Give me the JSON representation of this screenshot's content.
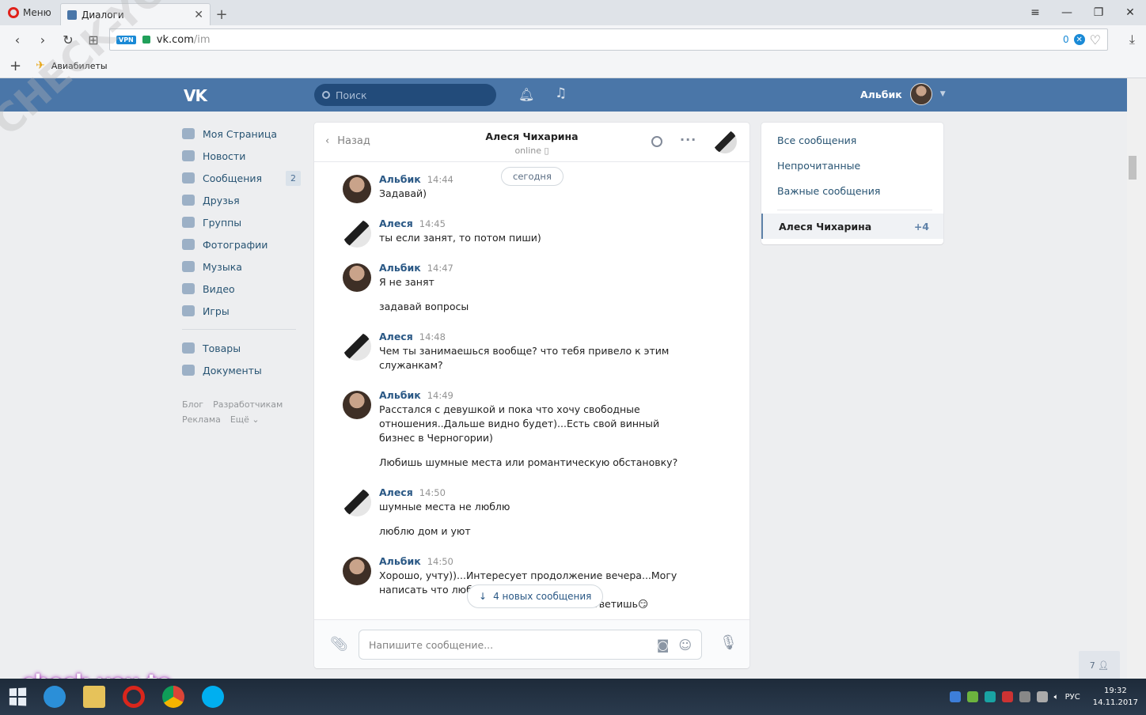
{
  "browser": {
    "menu_label": "Меню",
    "tab_title": "Диалоги",
    "url_host": "vk.com",
    "url_path": "/im",
    "adblock_count": "0",
    "bookmark": "Авиабилеты"
  },
  "header": {
    "search_placeholder": "Поиск",
    "user_name": "Альбик"
  },
  "leftnav": {
    "items": [
      {
        "label": "Моя Страница",
        "icon": "home-icon"
      },
      {
        "label": "Новости",
        "icon": "news-icon"
      },
      {
        "label": "Сообщения",
        "icon": "messages-icon",
        "badge": "2"
      },
      {
        "label": "Друзья",
        "icon": "friends-icon"
      },
      {
        "label": "Группы",
        "icon": "groups-icon"
      },
      {
        "label": "Фотографии",
        "icon": "camera-icon"
      },
      {
        "label": "Музыка",
        "icon": "music-icon"
      },
      {
        "label": "Видео",
        "icon": "video-icon"
      },
      {
        "label": "Игры",
        "icon": "gamepad-icon"
      },
      {
        "label": "Товары",
        "icon": "bag-icon"
      },
      {
        "label": "Документы",
        "icon": "document-icon"
      }
    ],
    "footer": [
      "Блог",
      "Разработчикам",
      "Реклама",
      "Ещё ⌄"
    ]
  },
  "chat": {
    "back_label": "Назад",
    "peer_name": "Алеся Чихарина",
    "peer_status": "online",
    "date_label": "сегодня",
    "messages": [
      {
        "author": "Альбик",
        "time": "14:44",
        "lines": [
          "Задавай)"
        ]
      },
      {
        "author": "Алеся",
        "time": "14:45",
        "lines": [
          "ты если занят, то потом пиши)"
        ]
      },
      {
        "author": "Альбик",
        "time": "14:47",
        "lines": [
          "Я не занят",
          "задавай вопросы"
        ]
      },
      {
        "author": "Алеся",
        "time": "14:48",
        "lines": [
          "Чем ты занимаешься вообще? что тебя привело к этим служанкам?"
        ]
      },
      {
        "author": "Альбик",
        "time": "14:49",
        "lines": [
          "Расстался с девушкой и пока что хочу свободные отношения..Дальше видно будет)...Есть свой винный бизнес в Черногории)",
          "Любишь шумные места или романтическую обстановку?"
        ]
      },
      {
        "author": "Алеся",
        "time": "14:50",
        "lines": [
          "шумные места не люблю",
          "люблю дом и уют"
        ]
      },
      {
        "author": "Альбик",
        "time": "14:50",
        "lines": [
          "Хорошо, учту))...Интересует продолжение вечера...Могу написать что любл",
          "ответишь😏"
        ]
      }
    ],
    "new_messages_label": "4 новых сообщения",
    "composer_placeholder": "Напишите сообщение..."
  },
  "rightpanel": {
    "filters": [
      "Все сообщения",
      "Непрочитанные",
      "Важные сообщения"
    ],
    "active_dialog": "Алеся Чихарина",
    "active_count": "+4"
  },
  "chat_people_count": "7",
  "watermarks": {
    "diagonal": "CHECK-YOU.ME",
    "bottom": "check-you.to"
  },
  "taskbar": {
    "lang": "РУС",
    "time": "19:32",
    "date": "14.11.2017"
  }
}
